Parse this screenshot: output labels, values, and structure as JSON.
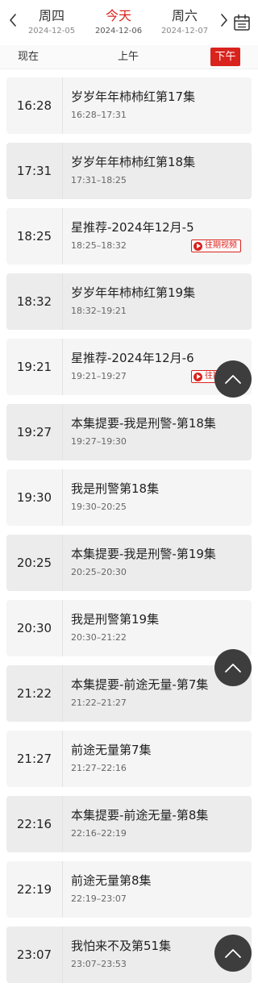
{
  "date_bar": {
    "days": [
      {
        "weekday": "周四",
        "date": "2024-12-05"
      },
      {
        "weekday": "今天",
        "date": "2024-12-06"
      },
      {
        "weekday": "周六",
        "date": "2024-12-07"
      }
    ],
    "active_index": 1,
    "prev_icon": "chevron-left-icon",
    "next_icon": "chevron-right-icon",
    "calendar_icon": "calendar-icon"
  },
  "period_bar": {
    "now": "现在",
    "am": "上午",
    "pm": "下午",
    "selected": "下午"
  },
  "accent_color": "#d9231d",
  "replay_label": "往期视频",
  "programs": [
    {
      "time": "16:28",
      "title": "岁岁年年柿柿红第17集",
      "range": "16:28–17:31"
    },
    {
      "time": "17:31",
      "title": "岁岁年年柿柿红第18集",
      "range": "17:31–18:25"
    },
    {
      "time": "18:25",
      "title": "星推荐-2024年12月-5",
      "range": "18:25–18:32",
      "replay": true
    },
    {
      "time": "18:32",
      "title": "岁岁年年柿柿红第19集",
      "range": "18:32–19:21"
    },
    {
      "time": "19:21",
      "title": "星推荐-2024年12月-6",
      "range": "19:21–19:27",
      "replay": true
    },
    {
      "time": "19:27",
      "title": "本集提要-我是刑警-第18集",
      "range": "19:27–19:30"
    },
    {
      "time": "19:30",
      "title": "我是刑警第18集",
      "range": "19:30–20:25"
    },
    {
      "time": "20:25",
      "title": "本集提要-我是刑警-第19集",
      "range": "20:25–20:30"
    },
    {
      "time": "20:30",
      "title": "我是刑警第19集",
      "range": "20:30–21:22"
    },
    {
      "time": "21:22",
      "title": "本集提要-前途无量-第7集",
      "range": "21:22–21:27"
    },
    {
      "time": "21:27",
      "title": "前途无量第7集",
      "range": "21:27–22:16"
    },
    {
      "time": "22:16",
      "title": "本集提要-前途无量-第8集",
      "range": "22:16–22:19"
    },
    {
      "time": "22:19",
      "title": "前途无量第8集",
      "range": "22:19–23:07"
    },
    {
      "time": "23:07",
      "title": "我怕来不及第51集",
      "range": "23:07–23:53"
    }
  ],
  "scroll_top_icon": "chevron-up-icon"
}
